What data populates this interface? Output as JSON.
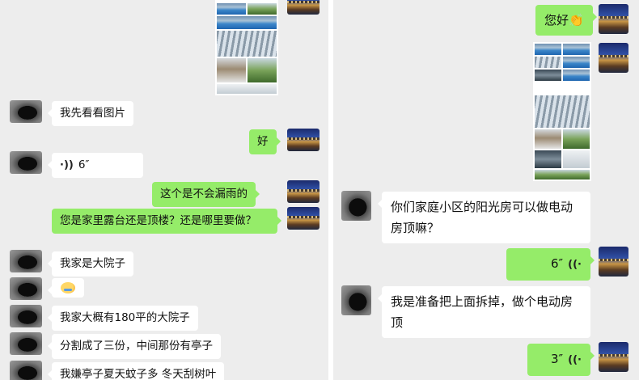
{
  "left": {
    "messages": [
      {
        "id": "l1",
        "type": "text",
        "side": "in",
        "text": "我先看看图片"
      },
      {
        "id": "l2",
        "type": "text",
        "side": "out",
        "text": "好"
      },
      {
        "id": "l3",
        "type": "voice",
        "side": "in",
        "duration": "6″"
      },
      {
        "id": "l4",
        "type": "text",
        "side": "out",
        "text": "这个是不会漏雨的"
      },
      {
        "id": "l5",
        "type": "text",
        "side": "out",
        "text": "您是家里露台还是顶楼？还是哪里要做？"
      },
      {
        "id": "l6",
        "type": "text",
        "side": "in",
        "text": "我家是大院子"
      },
      {
        "id": "l7",
        "type": "emoji",
        "side": "in",
        "emoji": "sweat-smile-emoji"
      },
      {
        "id": "l8",
        "type": "text",
        "side": "in",
        "text": "我家大概有180平的大院子"
      },
      {
        "id": "l9",
        "type": "text",
        "side": "in",
        "text": "分割成了三份，中间那份有亭子"
      },
      {
        "id": "l10",
        "type": "text",
        "side": "in",
        "text": "我嫌亭子夏天蚊子多 冬天刮树叶"
      }
    ]
  },
  "right": {
    "messages": [
      {
        "id": "r1",
        "type": "text",
        "side": "out",
        "text": "您好👏"
      },
      {
        "id": "r2",
        "type": "image",
        "side": "out",
        "icon": "photo-collage"
      },
      {
        "id": "r3",
        "type": "text",
        "side": "in",
        "text": "你们家庭小区的阳光房可以做电动房顶嘛？"
      },
      {
        "id": "r4",
        "type": "voice",
        "side": "out",
        "duration": "6″"
      },
      {
        "id": "r5",
        "type": "text",
        "side": "in",
        "text": "我是准备把上面拆掉，做个电动房顶"
      },
      {
        "id": "r6",
        "type": "voice",
        "side": "out",
        "duration": "3″"
      }
    ]
  },
  "colors": {
    "chat_bg": "#ededed",
    "outgoing_bubble": "#95ec69",
    "incoming_bubble": "#ffffff"
  }
}
